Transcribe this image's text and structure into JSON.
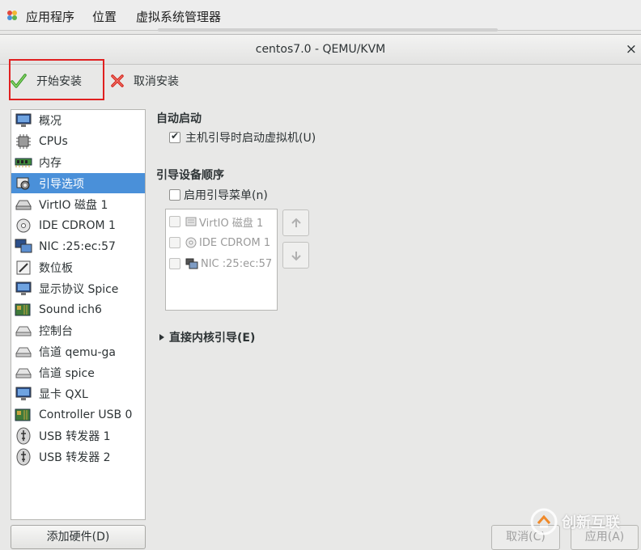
{
  "topbar": {
    "menus": [
      "应用程序",
      "位置",
      "虚拟系统管理器"
    ]
  },
  "window": {
    "title": "centos7.0 - QEMU/KVM",
    "close_glyph": "×"
  },
  "toolbar": {
    "begin_install": "开始安装",
    "cancel_install": "取消安装"
  },
  "sidebar": {
    "items": [
      {
        "label": "概况",
        "icon": "monitor-icon"
      },
      {
        "label": "CPUs",
        "icon": "cpu-icon"
      },
      {
        "label": "内存",
        "icon": "memory-icon"
      },
      {
        "label": "引导选项",
        "icon": "boot-options-icon",
        "selected": true
      },
      {
        "label": "VirtIO 磁盘 1",
        "icon": "disk-icon"
      },
      {
        "label": "IDE CDROM 1",
        "icon": "cdrom-icon"
      },
      {
        "label": "NIC :25:ec:57",
        "icon": "nic-icon"
      },
      {
        "label": "数位板",
        "icon": "tablet-icon"
      },
      {
        "label": "显示协议 Spice",
        "icon": "display-icon"
      },
      {
        "label": "Sound ich6",
        "icon": "sound-icon"
      },
      {
        "label": "控制台",
        "icon": "console-icon"
      },
      {
        "label": "信道 qemu-ga",
        "icon": "channel-icon"
      },
      {
        "label": "信道 spice",
        "icon": "channel-icon"
      },
      {
        "label": "显卡 QXL",
        "icon": "video-card-icon"
      },
      {
        "label": "Controller USB 0",
        "icon": "controller-icon"
      },
      {
        "label": "USB 转发器 1",
        "icon": "usb-redirector-icon"
      },
      {
        "label": "USB 转发器 2",
        "icon": "usb-redirector-icon"
      }
    ],
    "add_hardware": "添加硬件(D)"
  },
  "autostart": {
    "title": "自动启动",
    "checkbox_label": "主机引导时启动虚拟机(U)",
    "checked": true
  },
  "boot_order": {
    "title": "引导设备顺序",
    "menu_label": "启用引导菜单(n)",
    "menu_checked": false,
    "devices": [
      {
        "label": "VirtIO 磁盘 1",
        "icon": "disk-icon"
      },
      {
        "label": "IDE CDROM 1",
        "icon": "cdrom-icon"
      },
      {
        "label": "NIC :25:ec:57",
        "icon": "nic-icon"
      }
    ]
  },
  "direct_kernel": {
    "label": "直接内核引导(E)"
  },
  "buttons": {
    "cancel": "取消(C)",
    "apply": "应用(A)"
  },
  "watermark": "创新互联",
  "colors": {
    "selection": "#4a90d9",
    "highlight_box": "#e02020"
  }
}
